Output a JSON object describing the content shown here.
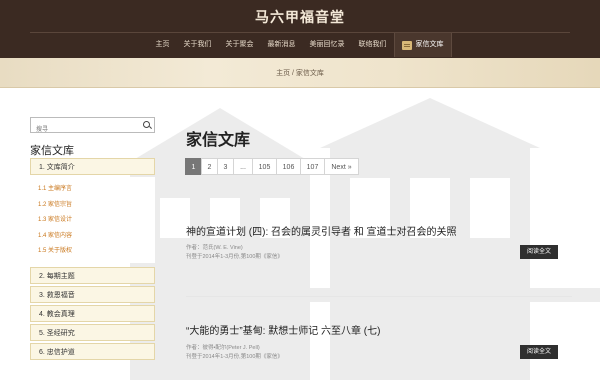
{
  "site": {
    "title": "马六甲福音堂"
  },
  "nav": {
    "items": [
      {
        "label": "主页"
      },
      {
        "label": "关于我们"
      },
      {
        "label": "关于聚会"
      },
      {
        "label": "最新消息"
      },
      {
        "label": "美丽回忆录"
      },
      {
        "label": "联络我们"
      },
      {
        "label": "家信文库",
        "active": true,
        "icon": "scroll-icon"
      }
    ]
  },
  "breadcrumb": {
    "text": "主页 / 家信文库"
  },
  "search": {
    "placeholder": "搜寻",
    "value": "",
    "icon": "search-icon"
  },
  "sidebar": {
    "title": "家信文库",
    "groups": [
      {
        "label": "1. 文库简介",
        "children": [
          "1.1 主编序言",
          "1.2 家信宗旨",
          "1.3 家信设计",
          "1.4 家信内容",
          "1.5 关于版权"
        ]
      },
      {
        "label": "2. 每期主题"
      },
      {
        "label": "3. 救恩福音"
      },
      {
        "label": "4. 教会真理"
      },
      {
        "label": "5. 圣经研究"
      },
      {
        "label": "6. 忠信护道"
      }
    ],
    "colors": {
      "box_bg": "#fbf6e4",
      "sub_link": "#c9761a"
    }
  },
  "main": {
    "title": "家信文库",
    "pagination": [
      "1",
      "2",
      "3",
      "...",
      "105",
      "106",
      "107",
      "Next »"
    ],
    "current_page": "1",
    "articles": [
      {
        "title": "神的宣道计划 (四): 召会的属灵引导者 和 宣道士对召会的关照",
        "author": "作者：范氏(W. E. Vine)",
        "published": "刊登于2014年1-3月份,第100期《家信》",
        "button": "阅读全文"
      },
      {
        "title": "“大能的勇士”基甸: 默想士师记 六至八章 (七)",
        "author": "作者：彼得•配尔(Peter J. Pell)",
        "published": "刊登于2014年1-3月份,第100期《家信》",
        "button": "阅读全文"
      }
    ]
  },
  "colors": {
    "header_bg": "#3b2a22",
    "accent": "#c9761a"
  }
}
